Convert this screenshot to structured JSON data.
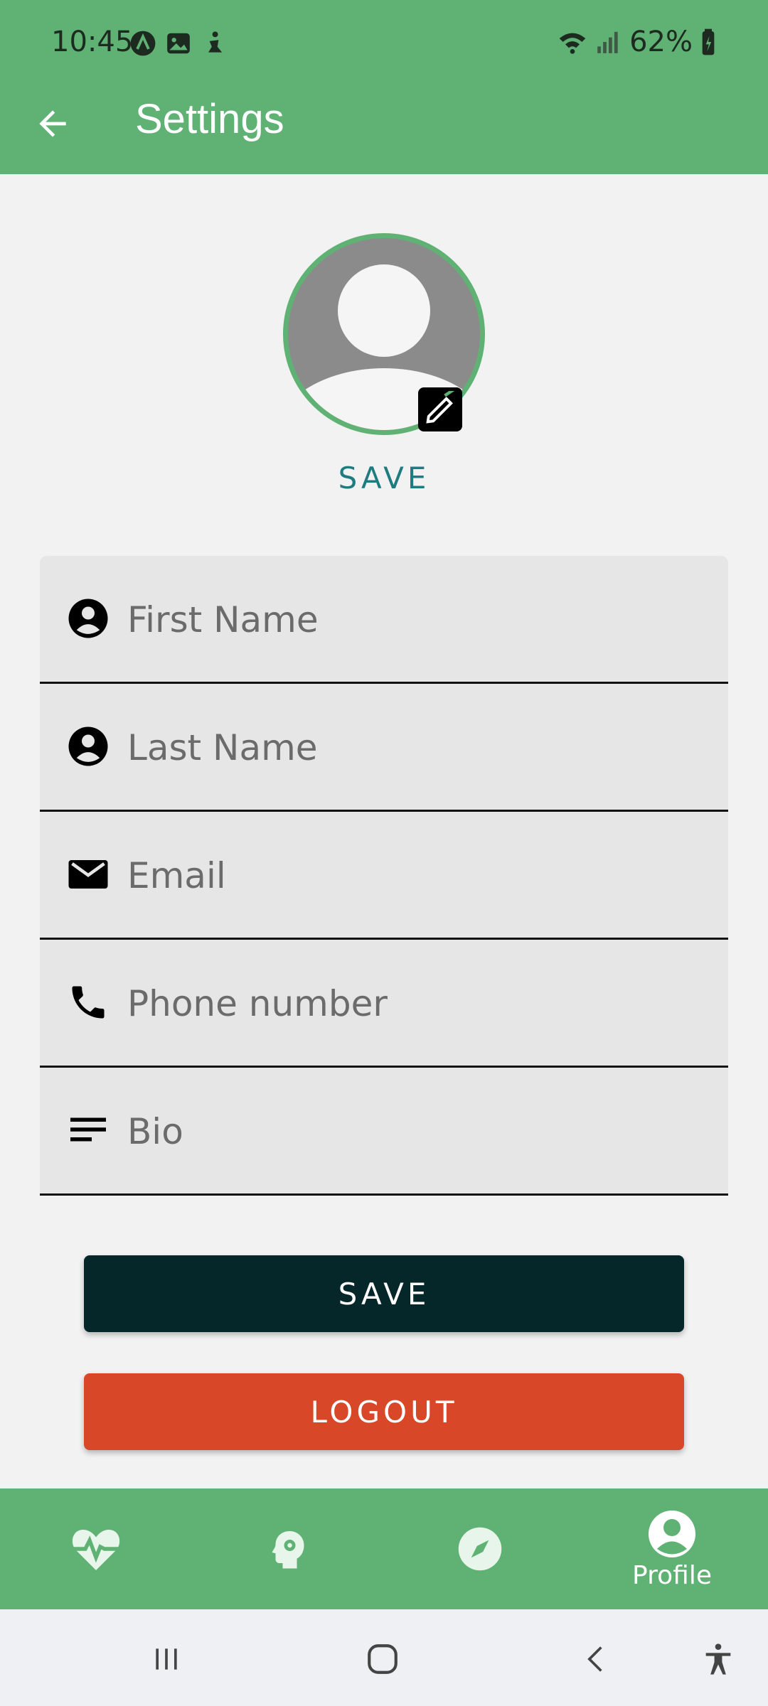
{
  "status_bar": {
    "time": "10:45",
    "battery": "62%"
  },
  "header": {
    "title": "Settings"
  },
  "profile": {
    "save_photo_label": "SAVE"
  },
  "form": {
    "fields": [
      {
        "placeholder": "First Name",
        "icon": "person-circle-icon"
      },
      {
        "placeholder": "Last Name",
        "icon": "person-circle-icon"
      },
      {
        "placeholder": "Email",
        "icon": "mail-icon"
      },
      {
        "placeholder": "Phone number",
        "icon": "phone-icon"
      },
      {
        "placeholder": "Bio",
        "icon": "lines-icon"
      }
    ]
  },
  "buttons": {
    "save_label": "SAVE",
    "logout_label": "LOGOUT"
  },
  "bottom_nav": {
    "items": [
      {
        "icon": "heart-pulse-icon",
        "label": ""
      },
      {
        "icon": "head-gear-icon",
        "label": ""
      },
      {
        "icon": "compass-icon",
        "label": ""
      },
      {
        "icon": "profile-icon",
        "label": "Profile"
      }
    ]
  },
  "colors": {
    "primary_green": "#5fb274",
    "save_button": "#05272a",
    "logout_button": "#d84727",
    "accent_teal": "#1d7c80"
  }
}
